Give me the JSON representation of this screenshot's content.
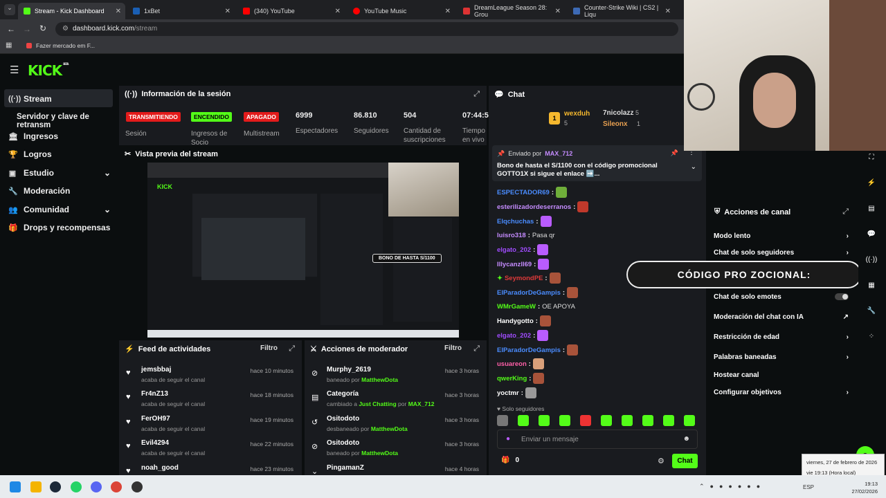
{
  "browser": {
    "tabs": [
      {
        "title": "Stream - Kick Dashboard",
        "color": "#53fc18",
        "active": true
      },
      {
        "title": "1xBet",
        "color": "#1a5fb4"
      },
      {
        "title": "(340) YouTube",
        "color": "#ff0000"
      },
      {
        "title": "YouTube Music",
        "color": "#ff0000"
      },
      {
        "title": "DreamLeague Season 28: Grou",
        "color": "#d33"
      },
      {
        "title": "Counter-Strike Wiki | CS2 | Liqu",
        "color": "#3d6ab5"
      }
    ],
    "url": "dashboard.kick.com",
    "url_path": "/stream",
    "bookmark": "Fazer mercado em F..."
  },
  "brand": {
    "logo": "KICK",
    "beta": "BETA",
    "accent": "#53fc18"
  },
  "sidebar": {
    "items": [
      {
        "label": "Stream",
        "icon": "stream-icon"
      },
      {
        "label": "Servidor y clave de retransm"
      },
      {
        "label": "Ingresos",
        "icon": "bank-icon"
      },
      {
        "label": "Logros",
        "icon": "trophy-icon"
      },
      {
        "label": "Estudio",
        "icon": "studio-icon"
      },
      {
        "label": "Moderación",
        "icon": "wrench-icon"
      },
      {
        "label": "Comunidad",
        "icon": "community-icon"
      },
      {
        "label": "Drops y recompensas",
        "icon": "gift-icon"
      }
    ]
  },
  "session": {
    "title": "Información de la sesión",
    "badges": [
      {
        "text": "TRANSMITIENDO",
        "label": "Sesión"
      },
      {
        "text": "ENCENDIDO",
        "label": "Ingresos de Socio"
      },
      {
        "text": "APAGADO",
        "label": "Multistream"
      }
    ],
    "stats": [
      {
        "value": "6999",
        "label": "Espectadores"
      },
      {
        "value": "86.810",
        "label": "Seguidores"
      },
      {
        "value": "504",
        "label": "Cantidad de suscripciones"
      },
      {
        "value": "07:44:5",
        "label": "Tiempo en vivo"
      }
    ]
  },
  "preview": {
    "title": "Vista previa del stream",
    "overlay_text": "BONO DE HASTA S/1100"
  },
  "feed": {
    "title": "Feed de actividades",
    "filter": "Filtro",
    "rows": [
      {
        "name": "jemsbbaj",
        "sub": "acaba de seguir el canal",
        "time": "hace 10 minutos"
      },
      {
        "name": "Fr4nZ13",
        "sub": "acaba de seguir el canal",
        "time": "hace 18 minutos"
      },
      {
        "name": "FerOH97",
        "sub": "acaba de seguir el canal",
        "time": "hace 19 minutos"
      },
      {
        "name": "Evil4294",
        "sub": "acaba de seguir el canal",
        "time": "hace 22 minutos"
      },
      {
        "name": "noah_good",
        "sub": "",
        "time": "hace 23 minutos"
      }
    ]
  },
  "modactions": {
    "title": "Acciones de moderador",
    "filter": "Filtro",
    "rows": [
      {
        "name": "Murphy_2619",
        "sub_pre": "baneado por",
        "sub_user": "MatthewDota",
        "time": "hace 3 horas"
      },
      {
        "name": "Categoría",
        "sub_pre": "cambiado a",
        "sub_user": "Just Chatting",
        "sub_mid": "por",
        "sub_user2": "MAX_712",
        "time": "hace 3 horas"
      },
      {
        "name": "Ositodoto",
        "sub_pre": "desbaneado por",
        "sub_user": "MatthewDota",
        "time": "hace 3 horas"
      },
      {
        "name": "Ositodoto",
        "sub_pre": "baneado por",
        "sub_user": "MatthewDota",
        "time": "hace 3 horas"
      },
      {
        "name": "PingamanZ",
        "time": "hace 4 horas"
      }
    ]
  },
  "chat": {
    "title": "Chat",
    "leaders": [
      {
        "name": "wexduh",
        "count": "5"
      },
      {
        "name": "7nicolazz",
        "count": "5"
      },
      {
        "name": "Sileonx",
        "count": "1"
      }
    ],
    "pinned": {
      "by": "Enviado por",
      "user": "MAX_712",
      "text": "Bono de hasta el S/1100 con el código promocional GOTTO1X si sigue el enlace ➡️..."
    },
    "messages": [
      {
        "user": "ESPECTADOR69",
        "color": "#4a8cff",
        "text": ""
      },
      {
        "user": "esterilizadordeserranos",
        "color": "#c58cff",
        "text": ""
      },
      {
        "user": "Elqchuchas",
        "color": "#4a8cff",
        "text": ""
      },
      {
        "user": "luisro318",
        "color": "#c58cff",
        "text": "Pasa qr"
      },
      {
        "user": "elgato_202",
        "color": "#a04cff",
        "text": ""
      },
      {
        "user": "Illycanzll69",
        "color": "#c58cff",
        "text": ""
      },
      {
        "user": "SeymondPE",
        "color": "#e03a3a",
        "text": ""
      },
      {
        "user": "ElParadorDeGampis",
        "color": "#4a8cff",
        "text": ""
      },
      {
        "user": "WMrGameW",
        "color": "#53fc18",
        "text": "OE APOYA"
      },
      {
        "user": "Handygotto",
        "color": "#ffffff",
        "text": ""
      },
      {
        "user": "elgato_202",
        "color": "#a04cff",
        "text": ""
      },
      {
        "user": "ElParadorDeGampis",
        "color": "#4a8cff",
        "text": ""
      },
      {
        "user": "usuareon",
        "color": "#ff5fa8",
        "text": ""
      },
      {
        "user": "qwerKing",
        "color": "#53fc18",
        "text": ""
      },
      {
        "user": "yoctmr",
        "color": "#ffffff",
        "text": ""
      }
    ],
    "mode": "Solo seguidores",
    "placeholder": "Enviar un mensaje",
    "points": "0",
    "send": "Chat"
  },
  "channel_actions": {
    "title": "Acciones de canal",
    "items": [
      {
        "label": "Modo lento",
        "type": "chevron"
      },
      {
        "label": "Chat de solo seguidores",
        "type": "chevron"
      },
      {
        "label": "",
        "type": "none"
      },
      {
        "label": "Chat de solo emotes",
        "type": "toggle"
      },
      {
        "label": "Moderación del chat con IA",
        "type": "external"
      },
      {
        "label": "Restricción de edad",
        "type": "chevron"
      },
      {
        "label": "Palabras baneadas",
        "type": "chevron"
      },
      {
        "label": "Hostear canal",
        "type": "none"
      },
      {
        "label": "Configurar objetivos",
        "type": "chevron"
      }
    ],
    "promo_banner": "CÓDIGO PRO ZOCIONAL:"
  },
  "tray": {
    "tooltip_date": "viernes, 27 de febrero de 2026",
    "tooltip_time": "vie 19:13 (Hora local)",
    "lang": "ESP",
    "time": "19:13",
    "date": "27/02/2026"
  }
}
